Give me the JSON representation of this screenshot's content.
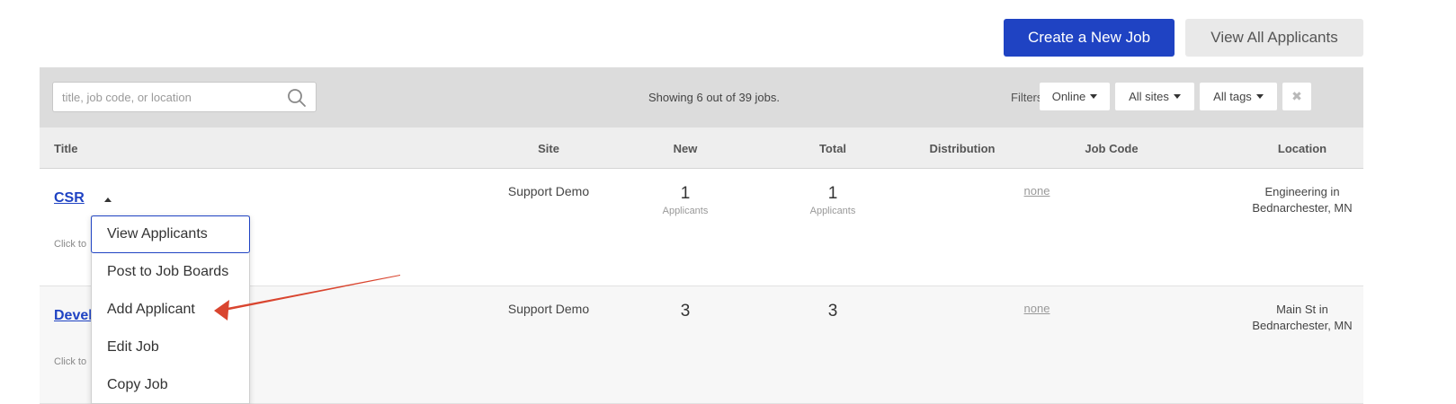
{
  "header": {
    "create_job_label": "Create a New Job",
    "view_all_label": "View All Applicants"
  },
  "filter_bar": {
    "search_placeholder": "title, job code, or location",
    "showing_text": "Showing 6 out of 39 jobs.",
    "filters_label": "Filters:",
    "status_filter": "Online",
    "sites_filter": "All sites",
    "tags_filter": "All tags",
    "clear_icon": "✖"
  },
  "columns": {
    "title": "Title",
    "site": "Site",
    "new": "New",
    "total": "Total",
    "distribution": "Distribution",
    "job_code": "Job Code",
    "location": "Location"
  },
  "jobs": [
    {
      "title": "CSR",
      "hint": "Click to",
      "site": "Support Demo",
      "new": "1",
      "new_label": "Applicants",
      "total": "1",
      "total_label": "Applicants",
      "distribution": "none",
      "job_code": "",
      "location_line1": "Engineering in",
      "location_line2": "Bednarchester, MN"
    },
    {
      "title": "Devel",
      "hint": "Click to",
      "site": "Support Demo",
      "new": "3",
      "total": "3",
      "distribution": "none",
      "job_code": "",
      "location_line1": "Main St in",
      "location_line2": "Bednarchester, MN"
    }
  ],
  "dropdown_menu": {
    "items": [
      "View Applicants",
      "Post to Job Boards",
      "Add Applicant",
      "Edit Job",
      "Copy Job"
    ]
  },
  "colors": {
    "primary": "#1f43c3",
    "annotation_arrow": "#d9452f"
  }
}
